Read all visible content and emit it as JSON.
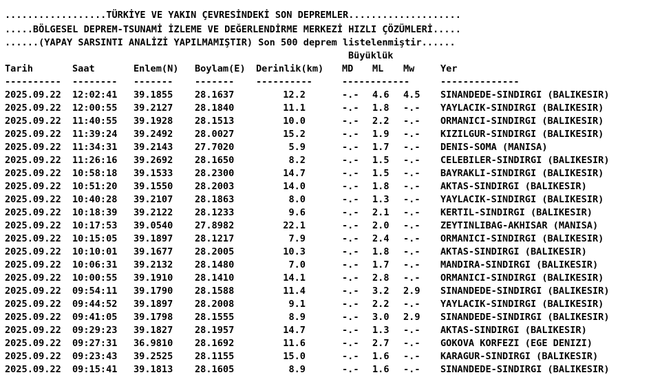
{
  "header": {
    "line1": "..................TÜRKİYE VE YAKIN ÇEVRESİNDEKİ SON DEPREMLER....................",
    "line2": ".....BÖLGESEL DEPREM-TSUNAMİ İZLEME VE DEĞERLENDİRME MERKEZİ HIZLI ÇÖZÜMLERİ.....",
    "line3": "......(YAPAY SARSINTI ANALİZİ YAPILMAMIŞTIR) Son 500 deprem listelenmiştir......"
  },
  "magnitude_group_label": "Büyüklük",
  "columns": {
    "tarih": "Tarih",
    "saat": "Saat",
    "enlem": "Enlem(N)",
    "boylam": "Boylam(E)",
    "derinlik": "Derinlik(km)",
    "md": "MD",
    "ml": "ML",
    "mw": "Mw",
    "yer": "Yer"
  },
  "separators": {
    "tarih": "----------",
    "saat": "--------",
    "enlem": "-------",
    "boylam": "-------",
    "derinlik": "----------",
    "mag": "------------",
    "yer": "--------------"
  },
  "rows": [
    {
      "date": "2025.09.22",
      "time": "12:02:41",
      "lat": "39.1855",
      "lon": "28.1637",
      "depth": "12.2",
      "md": "-.-",
      "ml": "4.6",
      "mw": "4.5",
      "place": "SINANDEDE-SINDIRGI (BALIKESIR)"
    },
    {
      "date": "2025.09.22",
      "time": "12:00:55",
      "lat": "39.2127",
      "lon": "28.1840",
      "depth": "11.1",
      "md": "-.-",
      "ml": "1.8",
      "mw": "-.-",
      "place": "YAYLACIK-SINDIRGI (BALIKESIR)"
    },
    {
      "date": "2025.09.22",
      "time": "11:40:55",
      "lat": "39.1928",
      "lon": "28.1513",
      "depth": "10.0",
      "md": "-.-",
      "ml": "2.2",
      "mw": "-.-",
      "place": "ORMANICI-SINDIRGI (BALIKESIR)"
    },
    {
      "date": "2025.09.22",
      "time": "11:39:24",
      "lat": "39.2492",
      "lon": "28.0027",
      "depth": "15.2",
      "md": "-.-",
      "ml": "1.9",
      "mw": "-.-",
      "place": "KIZILGUR-SINDIRGI (BALIKESIR)"
    },
    {
      "date": "2025.09.22",
      "time": "11:34:31",
      "lat": "39.2143",
      "lon": "27.7020",
      "depth": "5.9",
      "md": "-.-",
      "ml": "1.7",
      "mw": "-.-",
      "place": "DENIS-SOMA (MANISA)"
    },
    {
      "date": "2025.09.22",
      "time": "11:26:16",
      "lat": "39.2692",
      "lon": "28.1650",
      "depth": "8.2",
      "md": "-.-",
      "ml": "1.5",
      "mw": "-.-",
      "place": "CELEBILER-SINDIRGI (BALIKESIR)"
    },
    {
      "date": "2025.09.22",
      "time": "10:58:18",
      "lat": "39.1533",
      "lon": "28.2300",
      "depth": "14.7",
      "md": "-.-",
      "ml": "1.5",
      "mw": "-.-",
      "place": "BAYRAKLI-SINDIRGI (BALIKESIR)"
    },
    {
      "date": "2025.09.22",
      "time": "10:51:20",
      "lat": "39.1550",
      "lon": "28.2003",
      "depth": "14.0",
      "md": "-.-",
      "ml": "1.8",
      "mw": "-.-",
      "place": "AKTAS-SINDIRGI (BALIKESIR)"
    },
    {
      "date": "2025.09.22",
      "time": "10:40:28",
      "lat": "39.2107",
      "lon": "28.1863",
      "depth": "8.0",
      "md": "-.-",
      "ml": "1.3",
      "mw": "-.-",
      "place": "YAYLACIK-SINDIRGI (BALIKESIR)"
    },
    {
      "date": "2025.09.22",
      "time": "10:18:39",
      "lat": "39.2122",
      "lon": "28.1233",
      "depth": "9.6",
      "md": "-.-",
      "ml": "2.1",
      "mw": "-.-",
      "place": "KERTIL-SINDIRGI (BALIKESIR)"
    },
    {
      "date": "2025.09.22",
      "time": "10:17:53",
      "lat": "39.0540",
      "lon": "27.8982",
      "depth": "22.1",
      "md": "-.-",
      "ml": "2.0",
      "mw": "-.-",
      "place": "ZEYTINLIBAG-AKHISAR (MANISA)"
    },
    {
      "date": "2025.09.22",
      "time": "10:15:05",
      "lat": "39.1897",
      "lon": "28.1217",
      "depth": "7.9",
      "md": "-.-",
      "ml": "2.4",
      "mw": "-.-",
      "place": "ORMANICI-SINDIRGI (BALIKESIR)"
    },
    {
      "date": "2025.09.22",
      "time": "10:10:01",
      "lat": "39.1677",
      "lon": "28.2005",
      "depth": "10.3",
      "md": "-.-",
      "ml": "1.8",
      "mw": "-.-",
      "place": "AKTAS-SINDIRGI (BALIKESIR)"
    },
    {
      "date": "2025.09.22",
      "time": "10:06:31",
      "lat": "39.2132",
      "lon": "28.1480",
      "depth": "7.0",
      "md": "-.-",
      "ml": "1.7",
      "mw": "-.-",
      "place": "MANDIRA-SINDIRGI (BALIKESIR)"
    },
    {
      "date": "2025.09.22",
      "time": "10:00:55",
      "lat": "39.1910",
      "lon": "28.1410",
      "depth": "14.1",
      "md": "-.-",
      "ml": "2.8",
      "mw": "-.-",
      "place": "ORMANICI-SINDIRGI (BALIKESIR)"
    },
    {
      "date": "2025.09.22",
      "time": "09:54:11",
      "lat": "39.1790",
      "lon": "28.1588",
      "depth": "11.4",
      "md": "-.-",
      "ml": "3.2",
      "mw": "2.9",
      "place": "SINANDEDE-SINDIRGI (BALIKESIR)"
    },
    {
      "date": "2025.09.22",
      "time": "09:44:52",
      "lat": "39.1897",
      "lon": "28.2008",
      "depth": "9.1",
      "md": "-.-",
      "ml": "2.2",
      "mw": "-.-",
      "place": "YAYLACIK-SINDIRGI (BALIKESIR)"
    },
    {
      "date": "2025.09.22",
      "time": "09:41:05",
      "lat": "39.1798",
      "lon": "28.1555",
      "depth": "8.9",
      "md": "-.-",
      "ml": "3.0",
      "mw": "2.9",
      "place": "SINANDEDE-SINDIRGI (BALIKESIR)"
    },
    {
      "date": "2025.09.22",
      "time": "09:29:23",
      "lat": "39.1827",
      "lon": "28.1957",
      "depth": "14.7",
      "md": "-.-",
      "ml": "1.3",
      "mw": "-.-",
      "place": "AKTAS-SINDIRGI (BALIKESIR)"
    },
    {
      "date": "2025.09.22",
      "time": "09:27:31",
      "lat": "36.9810",
      "lon": "28.1692",
      "depth": "11.6",
      "md": "-.-",
      "ml": "2.7",
      "mw": "-.-",
      "place": "GOKOVA KORFEZI (EGE DENIZI)"
    },
    {
      "date": "2025.09.22",
      "time": "09:23:43",
      "lat": "39.2525",
      "lon": "28.1155",
      "depth": "15.0",
      "md": "-.-",
      "ml": "1.6",
      "mw": "-.-",
      "place": "KARAGUR-SINDIRGI (BALIKESIR)"
    },
    {
      "date": "2025.09.22",
      "time": "09:15:41",
      "lat": "39.1813",
      "lon": "28.1605",
      "depth": "8.9",
      "md": "-.-",
      "ml": "1.6",
      "mw": "-.-",
      "place": "SINANDEDE-SINDIRGI (BALIKESIR)"
    }
  ]
}
